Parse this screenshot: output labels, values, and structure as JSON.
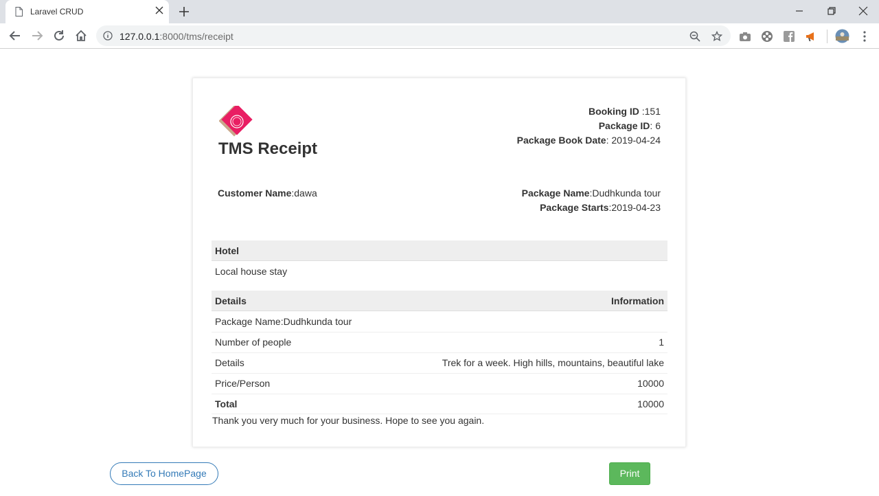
{
  "browser": {
    "tab_title": "Laravel CRUD",
    "url_host": "127.0.0.1",
    "url_rest": ":8000/tms/receipt"
  },
  "receipt": {
    "title": "TMS Receipt",
    "booking_id_label": "Booking ID",
    "booking_id_value": " :151",
    "package_id_label": "Package ID",
    "package_id_value": ": 6",
    "book_date_label": "Package Book Date",
    "book_date_value": ": 2019-04-24",
    "customer_label": "Customer Name",
    "customer_value": ":dawa",
    "package_name_label": "Package Name",
    "package_name_value": ":Dudhkunda tour",
    "package_starts_label": "Package Starts",
    "package_starts_value": ":2019-04-23"
  },
  "hotel_table": {
    "header": "Hotel",
    "value": "Local house stay"
  },
  "details_table": {
    "header_left": "Details",
    "header_right": "Information",
    "rows": [
      {
        "left": "Package Name:Dudhkunda tour",
        "right": ""
      },
      {
        "left": "Number of people",
        "right": "1"
      },
      {
        "left": "Details",
        "right": "Trek for a week. High hills, mountains, beautiful lake"
      },
      {
        "left": "Price/Person",
        "right": "10000"
      },
      {
        "left": "Total",
        "right": "10000"
      }
    ]
  },
  "thanks": "Thank you very much for your business. Hope to see you again.",
  "buttons": {
    "back": "Back To HomePage",
    "print": "Print"
  },
  "colors": {
    "accent": "#337ab7",
    "print_green": "#5cb85c",
    "logo_pink": "#e91e63",
    "logo_tan": "#c9a88b"
  }
}
